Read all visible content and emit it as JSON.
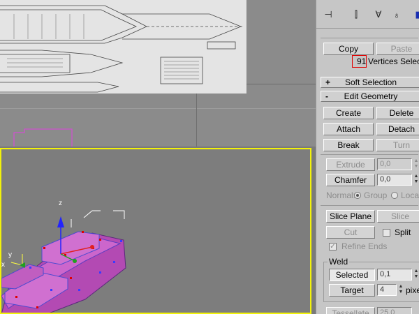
{
  "toolbar": {
    "icons": [
      "pin-stack-icon",
      "show-end-result-icon",
      "make-unique-icon",
      "remove-modifier-icon",
      "configure-sets-icon"
    ]
  },
  "panel": {
    "copy_label": "Copy",
    "paste_label": "Paste",
    "selection_count": "91",
    "selection_text": "Vertices Selected",
    "soft_selection": {
      "sign": "+",
      "title": "Soft Selection"
    },
    "edit_geometry": {
      "sign": "-",
      "title": "Edit Geometry"
    },
    "create_label": "Create",
    "delete_label": "Delete",
    "attach_label": "Attach",
    "detach_label": "Detach",
    "break_label": "Break",
    "turn_label": "Turn",
    "extrude_label": "Extrude",
    "extrude_value": "0,0",
    "chamfer_label": "Chamfer",
    "chamfer_value": "0,0",
    "normal_label": "Normal:",
    "group_label": "Group",
    "local_label": "Local",
    "slice_plane_label": "Slice Plane",
    "slice_label": "Slice",
    "cut_label": "Cut",
    "split_label": "Split",
    "refine_ends_label": "Refine Ends",
    "weld_title": "Weld",
    "selected_label": "Selected",
    "selected_value": "0,1",
    "target_label": "Target",
    "target_value": "4",
    "pixels_label": "pixels",
    "tessellate_label": "Tessellate",
    "tessellate_value": "25,0"
  },
  "viewport": {
    "axis_x": "x",
    "axis_y": "y",
    "axis_z": "z"
  }
}
